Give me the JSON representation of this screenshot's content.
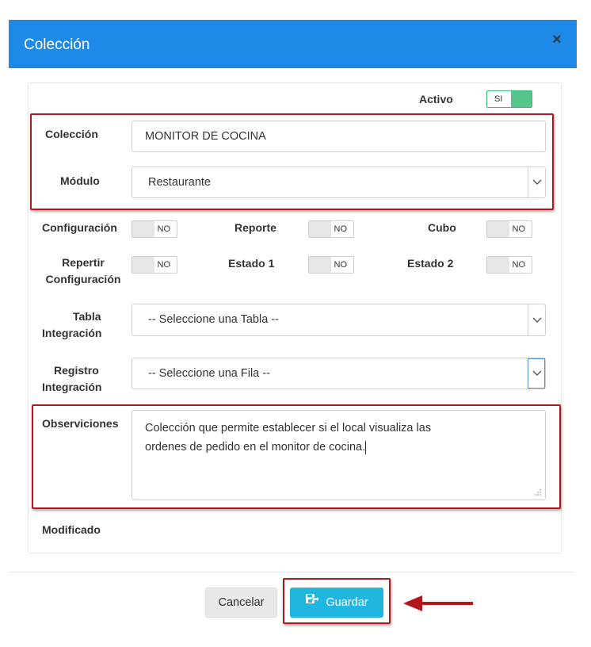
{
  "dialog": {
    "title": "Colección",
    "close_label": "×"
  },
  "form": {
    "activo": {
      "label": "Activo",
      "toggle_text": "SI",
      "on": true
    },
    "coleccion": {
      "label": "Colección",
      "value": "MONITOR DE COCINA"
    },
    "modulo": {
      "label": "Módulo",
      "value": "Restaurante"
    },
    "configuracion": {
      "label": "Configuración",
      "toggle_text": "NO"
    },
    "reporte": {
      "label": "Reporte",
      "toggle_text": "NO"
    },
    "cubo": {
      "label": "Cubo",
      "toggle_text": "NO"
    },
    "repertir": {
      "label_line1": "Repertir",
      "label_line2": "Configuración",
      "toggle_text": "NO"
    },
    "estado1": {
      "label": "Estado 1",
      "toggle_text": "NO"
    },
    "estado2": {
      "label": "Estado 2",
      "toggle_text": "NO"
    },
    "tabla_integracion": {
      "label_line1": "Tabla",
      "label_line2": "Integración",
      "value": "-- Seleccione una Tabla --"
    },
    "registro_integracion": {
      "label_line1": "Registro",
      "label_line2": "Integración",
      "value": "-- Seleccione una Fila --"
    },
    "observaciones": {
      "label": "Observiciones",
      "line1": "Colección que permite establecer si el local visualiza las",
      "line2": "ordenes de pedido en el monitor de cocina."
    },
    "modificado": {
      "label": "Modificado"
    }
  },
  "footer": {
    "cancel_label": "Cancelar",
    "save_label": "Guardar"
  },
  "colors": {
    "header": "#1c8ae6",
    "save_button": "#1fb6e0",
    "highlight": "#b5161d",
    "toggle_on": "#55c58c"
  },
  "icons": {
    "save": "save-icon",
    "close": "close-icon",
    "chevron": "chevron-down-icon",
    "annotation": "arrow-left-icon"
  }
}
